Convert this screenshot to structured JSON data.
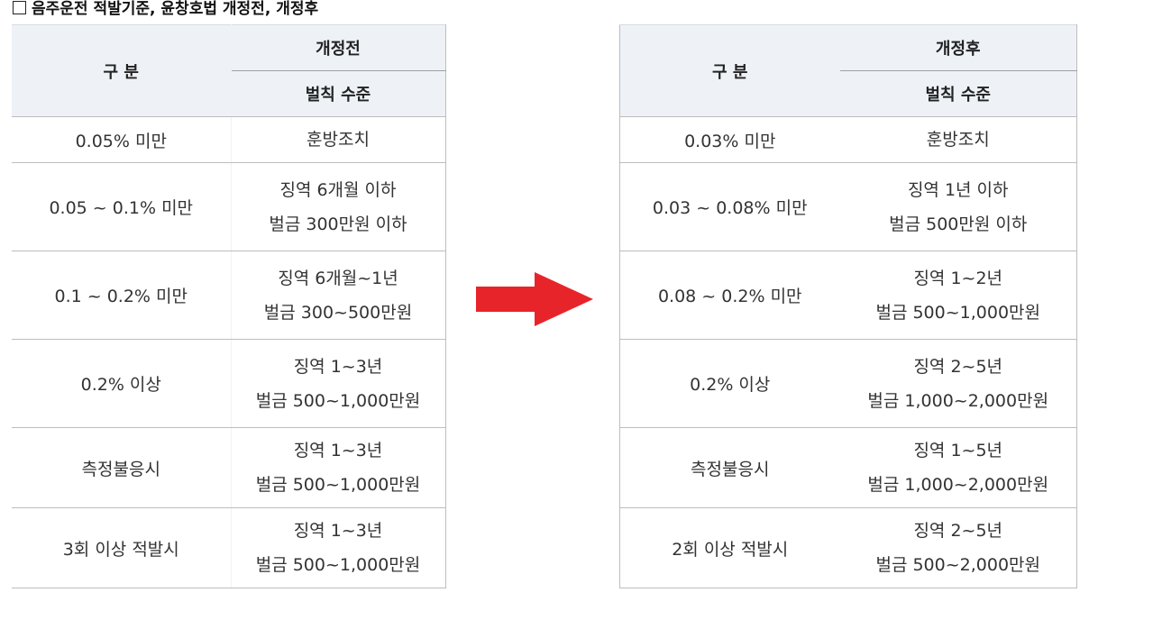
{
  "title": "음주운전 적발기준, 윤창호법 개정전, 개정후",
  "colors": {
    "header_bg": "#eef2f7",
    "arrow": "#e8242b",
    "border": "#bdbdbd"
  },
  "icons": {
    "checkbox": "checkbox-icon",
    "arrow": "right-arrow-icon"
  },
  "before": {
    "col1_header": "구 분",
    "col2_header": "개정전",
    "col2_subheader": "벌칙 수준",
    "rows": [
      {
        "criterion": "0.05% 미만",
        "penalty": [
          "훈방조치"
        ]
      },
      {
        "criterion": "0.05 ~ 0.1% 미만",
        "penalty": [
          "징역 6개월 이하",
          "벌금 300만원 이하"
        ]
      },
      {
        "criterion": "0.1 ~ 0.2% 미만",
        "penalty": [
          "징역 6개월~1년",
          "벌금 300~500만원"
        ]
      },
      {
        "criterion": "0.2% 이상",
        "penalty": [
          "징역 1~3년",
          "벌금 500~1,000만원"
        ]
      },
      {
        "criterion": "측정불응시",
        "penalty": [
          "징역 1~3년",
          "벌금 500~1,000만원"
        ]
      },
      {
        "criterion": "3회 이상 적발시",
        "penalty": [
          "징역 1~3년",
          "벌금 500~1,000만원"
        ]
      }
    ]
  },
  "after": {
    "col1_header": "구 분",
    "col2_header": "개정후",
    "col2_subheader": "벌칙 수준",
    "rows": [
      {
        "criterion": "0.03% 미만",
        "penalty": [
          "훈방조치"
        ]
      },
      {
        "criterion": "0.03 ~ 0.08% 미만",
        "penalty": [
          "징역 1년 이하",
          "벌금 500만원 이하"
        ]
      },
      {
        "criterion": "0.08 ~ 0.2% 미만",
        "penalty": [
          "징역 1~2년",
          "벌금 500~1,000만원"
        ]
      },
      {
        "criterion": "0.2% 이상",
        "penalty": [
          "징역 2~5년",
          "벌금 1,000~2,000만원"
        ]
      },
      {
        "criterion": "측정불응시",
        "penalty": [
          "징역 1~5년",
          "벌금 1,000~2,000만원"
        ]
      },
      {
        "criterion": "2회 이상 적발시",
        "penalty": [
          "징역 2~5년",
          "벌금 500~2,000만원"
        ]
      }
    ]
  }
}
